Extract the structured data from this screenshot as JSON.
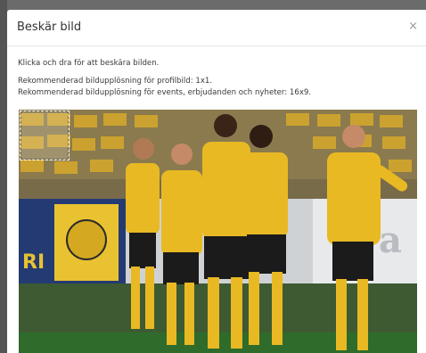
{
  "dialog": {
    "title": "Beskär bild",
    "close_glyph": "×",
    "instruction": "Klicka och dra för att beskära bilden.",
    "rec_profile": "Rekommenderad bildupplösning för profilbild: 1x1.",
    "rec_events": "Rekommenderad bildupplösning för events, erbjudanden och nyheter: 16x9."
  },
  "image": {
    "sponsor_text": "dra",
    "billboard_text": "RI"
  },
  "colors": {
    "jersey": "#e8b923",
    "shorts": "#1b1b1b",
    "stand_seat": "#d7a92a",
    "pitch": "#2f6b2a",
    "banner": "#e9c232"
  }
}
